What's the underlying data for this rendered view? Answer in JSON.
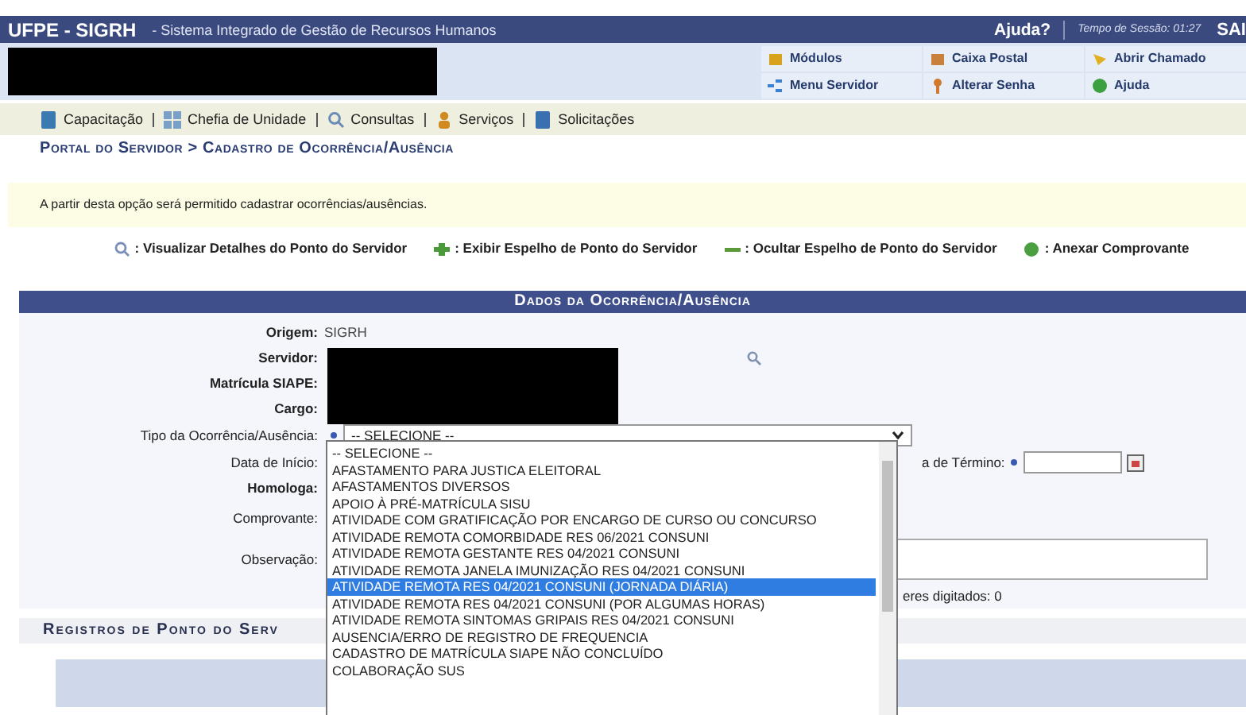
{
  "header": {
    "title": "UFPE - SIGRH",
    "subtitle": "- Sistema Integrado de Gestão de Recursos Humanos",
    "help": "Ajuda?",
    "session": "Tempo de Sessão: 01:27",
    "logout": "SAI"
  },
  "quick_links": [
    {
      "label": "Módulos",
      "kind": "box"
    },
    {
      "label": "Caixa Postal",
      "kind": "mail"
    },
    {
      "label": "Abrir Chamado",
      "kind": "bell"
    },
    {
      "label": "Menu Servidor",
      "kind": "tree"
    },
    {
      "label": "Alterar Senha",
      "kind": "key"
    },
    {
      "label": "Ajuda",
      "kind": "help"
    }
  ],
  "menu": [
    {
      "label": "Capacitação",
      "kind": "book"
    },
    {
      "label": "Chefia de Unidade",
      "kind": "grid"
    },
    {
      "label": "Consultas",
      "kind": "search"
    },
    {
      "label": "Serviços",
      "kind": "person"
    },
    {
      "label": "Solicitações",
      "kind": "doc"
    }
  ],
  "breadcrumb": "Portal do Servidor > Cadastro de Ocorrência/Ausência",
  "info": "A partir desta opção será permitido cadastrar ocorrências/ausências.",
  "legend": [
    {
      "label": ": Visualizar Detalhes do Ponto do Servidor",
      "kind": "search"
    },
    {
      "label": ": Exibir Espelho de Ponto do Servidor",
      "kind": "plus"
    },
    {
      "label": ": Ocultar Espelho de Ponto do Servidor",
      "kind": "minus"
    },
    {
      "label": ": Anexar Comprovante",
      "kind": "attach"
    }
  ],
  "form": {
    "title": "Dados da Ocorrência/Ausência",
    "info_rows": [
      {
        "label": "Origem:",
        "value": "SIGRH"
      },
      {
        "label": "Servidor:"
      },
      {
        "label": "Matrícula SIAPE:"
      },
      {
        "label": "Cargo:"
      }
    ],
    "type_label": "Tipo da Ocorrência/Ausência:",
    "type_value": "-- SELECIONE --",
    "options": [
      {
        "label": "-- SELECIONE --",
        "selected": false
      },
      {
        "label": "AFASTAMENTO PARA JUSTICA ELEITORAL",
        "selected": false
      },
      {
        "label": "AFASTAMENTOS DIVERSOS",
        "selected": false
      },
      {
        "label": "APOIO À PRÉ-MATRÍCULA SISU",
        "selected": false
      },
      {
        "label": "ATIVIDADE COM GRATIFICAÇÃO POR ENCARGO DE CURSO OU CONCURSO",
        "selected": false
      },
      {
        "label": "ATIVIDADE REMOTA COMORBIDADE RES 06/2021 CONSUNI",
        "selected": false
      },
      {
        "label": "ATIVIDADE REMOTA GESTANTE RES 04/2021 CONSUNI",
        "selected": false
      },
      {
        "label": "ATIVIDADE REMOTA JANELA IMUNIZAÇÃO RES 04/2021 CONSUNI",
        "selected": false
      },
      {
        "label": "ATIVIDADE REMOTA RES 04/2021 CONSUNI (JORNADA DIÁRIA)",
        "selected": true
      },
      {
        "label": "ATIVIDADE REMOTA RES 04/2021 CONSUNI (POR ALGUMAS HORAS)",
        "selected": false
      },
      {
        "label": "ATIVIDADE REMOTA SINTOMAS GRIPAIS RES 04/2021 CONSUNI",
        "selected": false
      },
      {
        "label": "AUSENCIA/ERRO DE REGISTRO DE FREQUENCIA",
        "selected": false
      },
      {
        "label": "CADASTRO DE MATRÍCULA SIAPE NÃO CONCLUÍDO",
        "selected": false
      },
      {
        "label": "COLABORAÇÃO SUS",
        "selected": false
      }
    ],
    "start_label": "Data de Início:",
    "end_label": "a de Término:",
    "homologa_label": "Homologa:",
    "comprovante_label": "Comprovante:",
    "obs_label": "Observação:",
    "counter": "eres digitados: 0"
  },
  "records_title": "Registros de Ponto do Serv"
}
